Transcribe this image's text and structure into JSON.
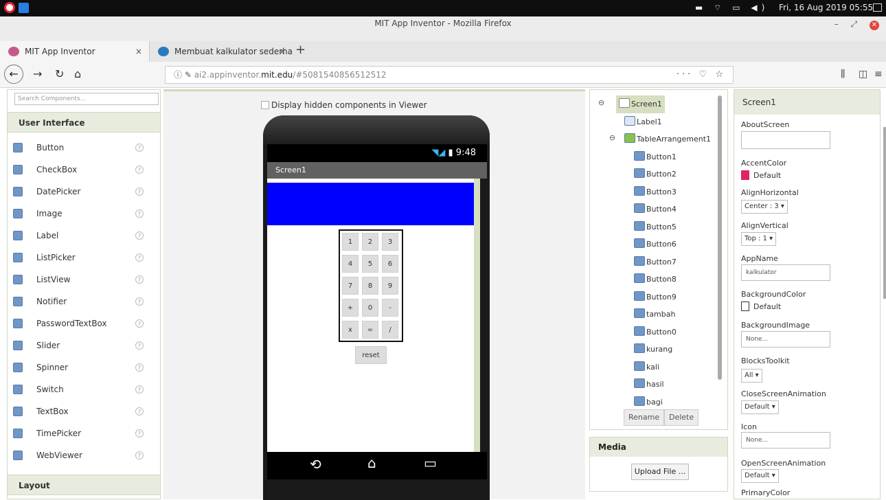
{
  "os": {
    "clock": "Fri, 16 Aug 2019 05:55"
  },
  "window": {
    "title": "MIT App Inventor - Mozilla Firefox"
  },
  "tabs": [
    {
      "label": "MIT App Inventor",
      "close": "×"
    },
    {
      "label": "Membuat kalkulator sederha",
      "close": "×"
    }
  ],
  "nav": {
    "url_prefix": "ai2.appinventor.",
    "url_domain": "mit.edu",
    "url_rest": "/#5081540856512512"
  },
  "palette": {
    "search_placeholder": "Search Components...",
    "section_ui": "User Interface",
    "section_layout": "Layout",
    "items": [
      "Button",
      "CheckBox",
      "DatePicker",
      "Image",
      "Label",
      "ListPicker",
      "ListView",
      "Notifier",
      "PasswordTextBox",
      "Slider",
      "Spinner",
      "Switch",
      "TextBox",
      "TimePicker",
      "WebViewer"
    ],
    "help": "?"
  },
  "viewer": {
    "hidden_label": "Display hidden components in Viewer",
    "status_time": "9:48",
    "screen_title": "Screen1",
    "buttons": [
      "1",
      "2",
      "3",
      "4",
      "5",
      "6",
      "7",
      "8",
      "9",
      "+",
      "0",
      "-",
      "x",
      "=",
      "/"
    ],
    "reset": "reset"
  },
  "tree": {
    "items": [
      "Screen1",
      "Label1",
      "TableArrangement1",
      "Button1",
      "Button2",
      "Button3",
      "Button4",
      "Button5",
      "Button6",
      "Button7",
      "Button8",
      "Button9",
      "tambah",
      "Button0",
      "kurang",
      "kali",
      "hasil",
      "bagi"
    ],
    "rename": "Rename",
    "delete": "Delete"
  },
  "media": {
    "title": "Media",
    "upload": "Upload File ..."
  },
  "props": {
    "header": "Screen1",
    "AboutScreen": "AboutScreen",
    "AccentColor": "AccentColor",
    "AccentColorVal": "Default",
    "AlignHorizontal": "AlignHorizontal",
    "AlignHorizontalVal": "Center : 3 ▾",
    "AlignVertical": "AlignVertical",
    "AlignVerticalVal": "Top : 1 ▾",
    "AppName": "AppName",
    "AppNameVal": "kalkulator",
    "BackgroundColor": "BackgroundColor",
    "BackgroundColorVal": "Default",
    "BackgroundImage": "BackgroundImage",
    "BackgroundImageVal": "None...",
    "BlocksToolkit": "BlocksToolkit",
    "BlocksToolkitVal": "All ▾",
    "CloseScreenAnimation": "CloseScreenAnimation",
    "CloseScreenAnimationVal": "Default ▾",
    "Icon": "Icon",
    "IconVal": "None...",
    "OpenScreenAnimation": "OpenScreenAnimation",
    "OpenScreenAnimationVal": "Default ▾",
    "PrimaryColor": "PrimaryColor"
  },
  "colors": {
    "accent": "#e0245e",
    "blue": "#0000ff",
    "panel": "#e8ecdf"
  }
}
